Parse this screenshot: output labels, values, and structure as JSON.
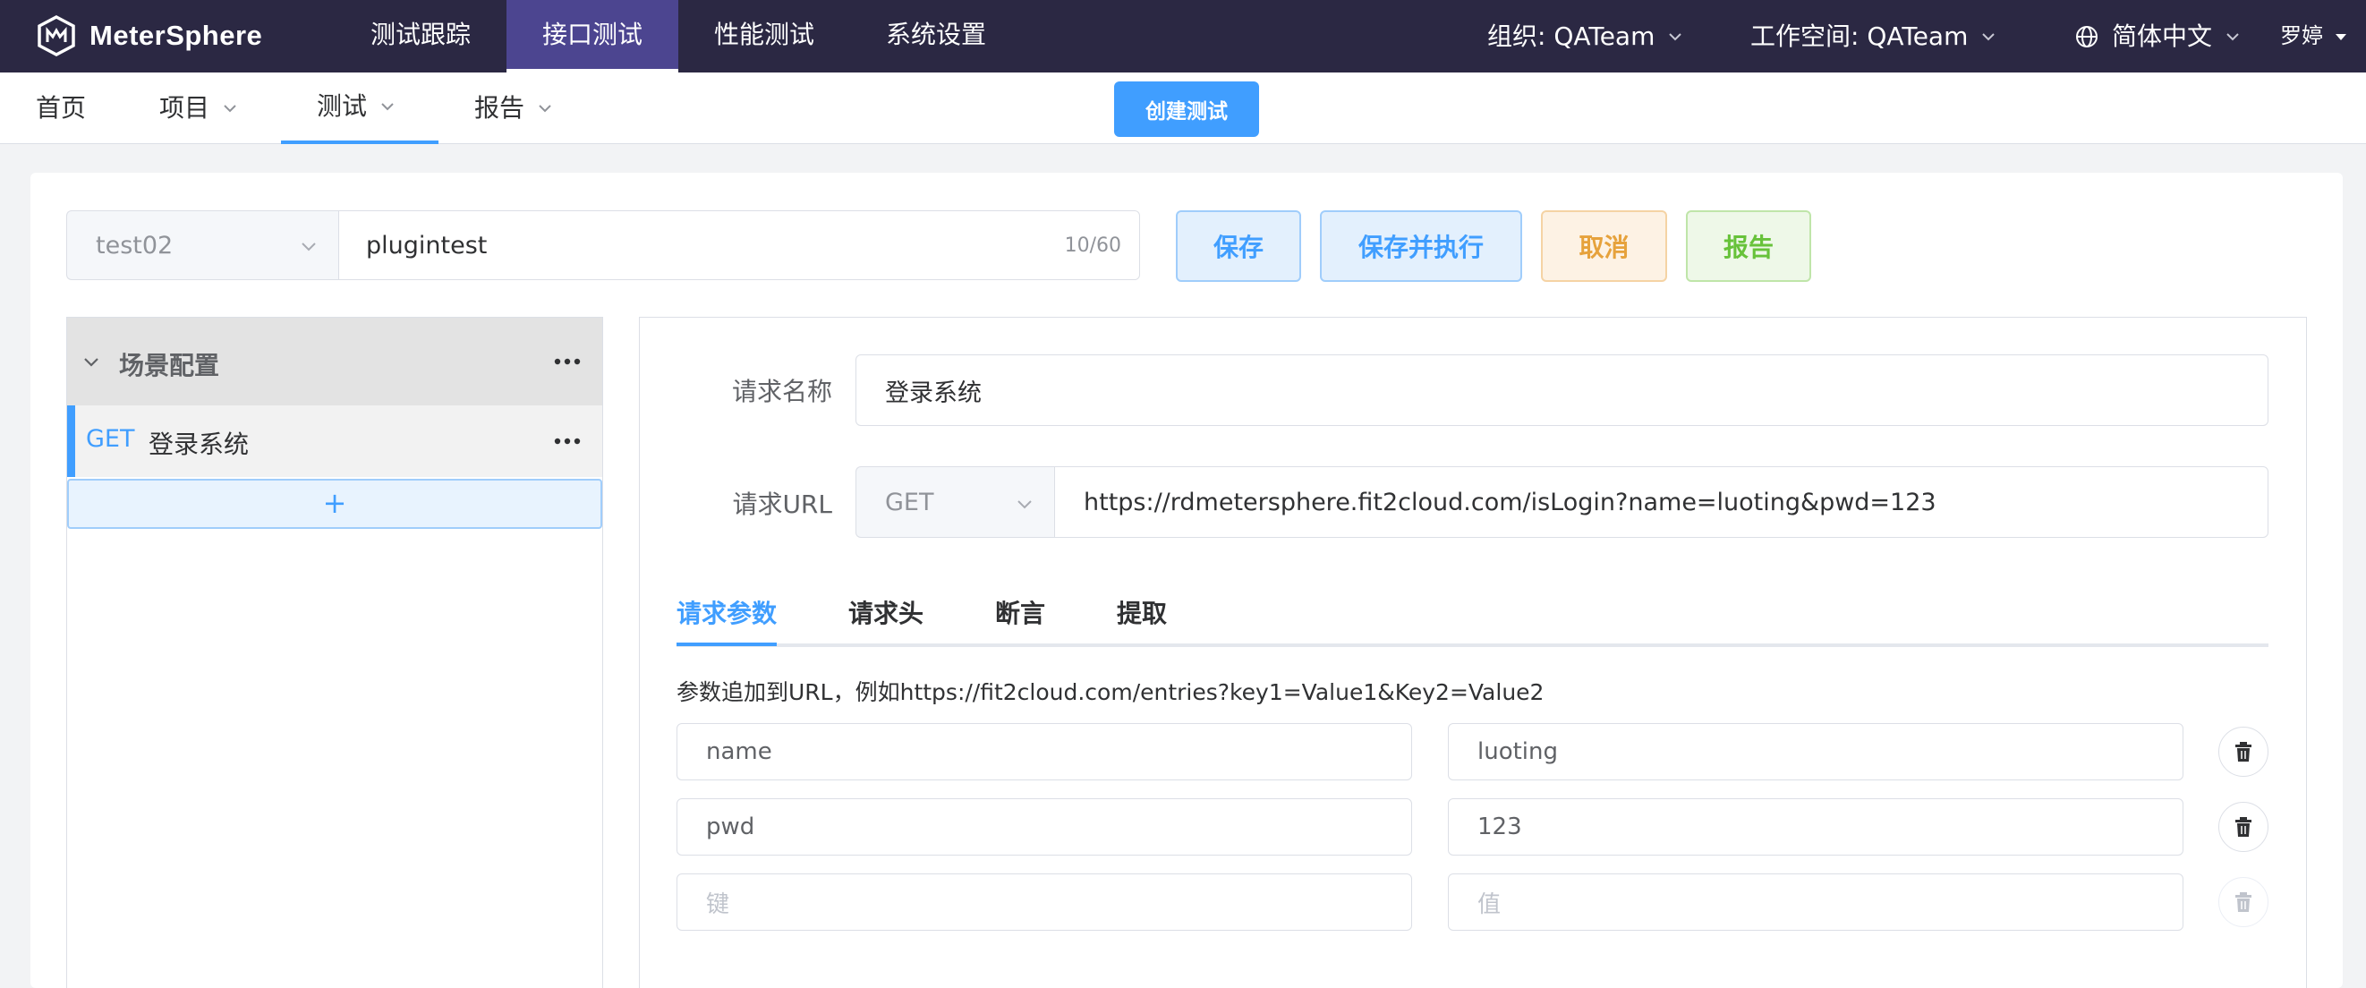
{
  "app": {
    "name": "MeterSphere"
  },
  "top_menu": {
    "items": [
      {
        "label": "测试跟踪"
      },
      {
        "label": "接口测试"
      },
      {
        "label": "性能测试"
      },
      {
        "label": "系统设置"
      }
    ],
    "active": "接口测试"
  },
  "top_right": {
    "org": "组织: QATeam",
    "workspace": "工作空间: QATeam",
    "language": "简体中文",
    "user": "罗婷"
  },
  "subnav": {
    "home": "首页",
    "project": "项目",
    "test": "测试",
    "report": "报告",
    "active": "测试",
    "create_button": "创建测试"
  },
  "test_form": {
    "project_select": "test02",
    "name_value": "plugintest",
    "name_counter": "10/60",
    "buttons": {
      "save": "保存",
      "save_and_run": "保存并执行",
      "cancel": "取消",
      "report": "报告"
    }
  },
  "scenario": {
    "header": "场景配置",
    "items": [
      {
        "method": "GET",
        "name": "登录系统"
      }
    ],
    "add_symbol": "+"
  },
  "request": {
    "name_label": "请求名称",
    "name_value": "登录系统",
    "url_label": "请求URL",
    "method": "GET",
    "url_value": "https://rdmetersphere.fit2cloud.com/isLogin?name=luoting&pwd=123",
    "tabs": [
      {
        "label": "请求参数"
      },
      {
        "label": "请求头"
      },
      {
        "label": "断言"
      },
      {
        "label": "提取"
      }
    ],
    "active_tab": "请求参数",
    "params_hint": "参数追加到URL，例如https://fit2cloud.com/entries?key1=Value1&Key2=Value2",
    "params": [
      {
        "key": "name",
        "value": "luoting"
      },
      {
        "key": "pwd",
        "value": "123"
      }
    ],
    "key_placeholder": "键",
    "value_placeholder": "值"
  },
  "colors": {
    "topbar_bg": "#2b2843",
    "active_menu_bg": "#4c4590",
    "primary": "#409eff",
    "warning": "#e6a23c",
    "success": "#67c23a"
  }
}
